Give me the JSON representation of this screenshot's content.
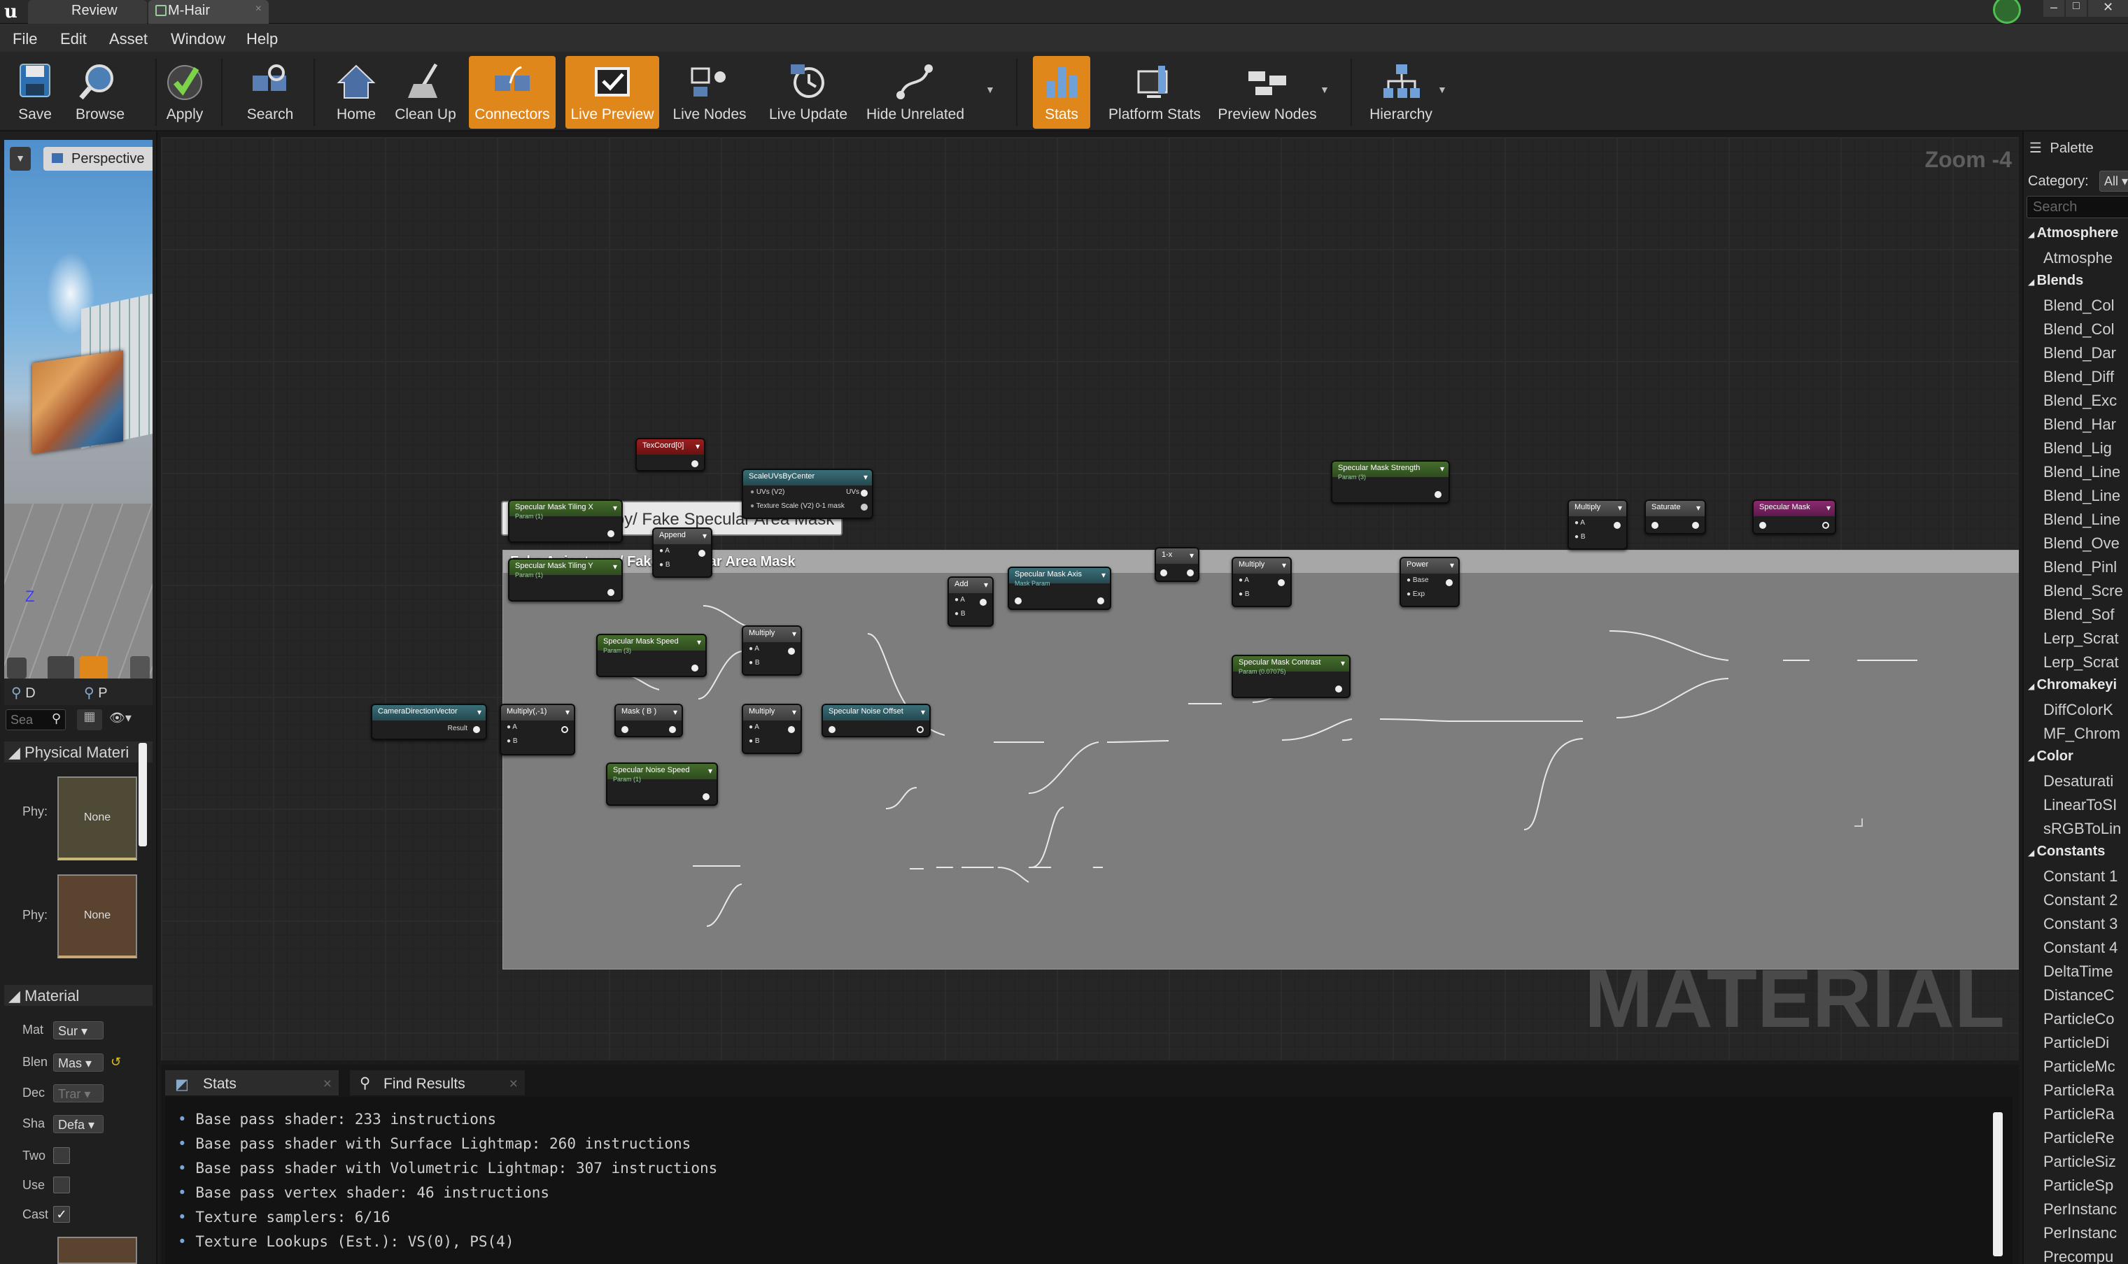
{
  "titlebar": {
    "tabs": [
      "Review",
      "M-Hair"
    ]
  },
  "menu": [
    "File",
    "Edit",
    "Asset",
    "Window",
    "Help"
  ],
  "toolbar": [
    {
      "label": "Save",
      "icon": "save-icon",
      "active": false
    },
    {
      "label": "Browse",
      "icon": "browse-icon",
      "active": false
    },
    {
      "label": "Apply",
      "icon": "apply-icon",
      "active": false
    },
    {
      "label": "Search",
      "icon": "search-icon",
      "active": false
    },
    {
      "label": "Home",
      "icon": "home-icon",
      "active": false
    },
    {
      "label": "Clean Up",
      "icon": "clean-up-icon",
      "active": false
    },
    {
      "label": "Connectors",
      "icon": "connectors-icon",
      "active": true
    },
    {
      "label": "Live Preview",
      "icon": "live-preview-icon",
      "active": true
    },
    {
      "label": "Live Nodes",
      "icon": "live-nodes-icon",
      "active": false
    },
    {
      "label": "Live Update",
      "icon": "live-update-icon",
      "active": false
    },
    {
      "label": "Hide Unrelated",
      "icon": "hide-unrelated-icon",
      "active": false
    },
    {
      "label": "Stats",
      "icon": "stats-icon",
      "active": true
    },
    {
      "label": "Platform Stats",
      "icon": "platform-stats-icon",
      "active": false
    },
    {
      "label": "Preview Nodes",
      "icon": "preview-nodes-icon",
      "active": false
    },
    {
      "label": "Hierarchy",
      "icon": "hierarchy-icon",
      "active": false
    }
  ],
  "viewport": {
    "mode": "Perspective"
  },
  "details": {
    "tabs": [
      "D",
      "P"
    ],
    "search_placeholder": "Sea",
    "section_physical": "Physical Materi",
    "phys_label": "Phy:",
    "phys_none": "None",
    "section_material": "Material",
    "rows": [
      {
        "k": "Mat",
        "v": "Sur"
      },
      {
        "k": "Blen",
        "v": "Mas"
      },
      {
        "k": "Dec",
        "v": "Trar"
      },
      {
        "k": "Sha",
        "v": "Defa"
      }
    ],
    "checks": [
      {
        "k": "Two",
        "checked": false
      },
      {
        "k": "Use",
        "checked": false
      },
      {
        "k": "Cast",
        "checked": true
      }
    ]
  },
  "graph": {
    "zoom": "Zoom -4",
    "watermark": "MATERIAL",
    "comment_bubble": "Fake Anisotropy/ Fake Specular Area Mask",
    "comment_title": "Fake Anisotropy/ Fake Specular Area Mask",
    "nodes": {
      "texcoord": "TexCoord[0]",
      "scaleuv": "ScaleUVsByCenter",
      "scaleuv_in1": "UVs (V2)",
      "scaleuv_in2": "Texture Scale (V2) 0-1 mask",
      "scaleuv_out": "UVs",
      "tilingx": "Specular Mask Tiling X",
      "tilingx_sub": "Param (1)",
      "tilingy": "Specular Mask Tiling Y",
      "tilingy_sub": "Param (1)",
      "append": "Append",
      "speed": "Specular Mask Speed",
      "speed_sub": "Param (3)",
      "camera": "CameraDirectionVector",
      "camera_out": "Result",
      "mulneg": "Multiply(,-1)",
      "mask": "Mask ( B )",
      "multiply1": "Multiply",
      "multiply2": "Multiply",
      "noiseoffset": "Specular Noise Offset",
      "noisespeed": "Specular Noise Speed",
      "noisespeed_sub": "Param (1)",
      "add": "Add",
      "axis": "Specular Mask Axis",
      "axis_sub": "Mask Param",
      "oneminus": "1-x",
      "multiply3": "Multiply",
      "strength": "Specular Mask Strength",
      "strength_sub": "Param (3)",
      "contrast": "Specular Mask Contrast",
      "contrast_sub": "Param (0.07075)",
      "power": "Power",
      "power_base": "Base",
      "power_exp": "Exp",
      "multiply4": "Multiply",
      "saturate": "Saturate",
      "specmask": "Specular Mask",
      "pin_a": "A",
      "pin_b": "B"
    }
  },
  "palette": {
    "title": "Palette",
    "category_label": "Category:",
    "category_value": "All",
    "search_placeholder": "Search",
    "groups": [
      {
        "name": "Atmosphere",
        "items": [
          "Atmosphe"
        ]
      },
      {
        "name": "Blends",
        "items": [
          "Blend_Col",
          "Blend_Col",
          "Blend_Dar",
          "Blend_Diff",
          "Blend_Exc",
          "Blend_Har",
          "Blend_Lig",
          "Blend_Line",
          "Blend_Line",
          "Blend_Line",
          "Blend_Ove",
          "Blend_Pinl",
          "Blend_Scre",
          "Blend_Sof",
          "Lerp_Scrat",
          "Lerp_Scrat"
        ]
      },
      {
        "name": "Chromakeyi",
        "items": [
          "DiffColorK",
          "MF_Chrom"
        ]
      },
      {
        "name": "Color",
        "items": [
          "Desaturati",
          "LinearToSI",
          "sRGBToLin"
        ]
      },
      {
        "name": "Constants",
        "items": [
          "Constant 1",
          "Constant 2",
          "Constant 3",
          "Constant 4",
          "DeltaTime",
          "DistanceC",
          "ParticleCo",
          "ParticleDi",
          "ParticleMc",
          "ParticleRa",
          "ParticleRa",
          "ParticleRe",
          "ParticleSiz",
          "ParticleSp",
          "PerInstanc",
          "PerInstanc",
          "Precompu"
        ]
      }
    ]
  },
  "bottom": {
    "tabs": [
      "Stats",
      "Find Results"
    ],
    "stats": [
      "Base pass shader: 233 instructions",
      "Base pass shader with Surface Lightmap: 260 instructions",
      "Base pass shader with Volumetric Lightmap: 307 instructions",
      "Base pass vertex shader: 46 instructions",
      "Texture samplers: 6/16",
      "Texture Lookups (Est.): VS(0), PS(4)"
    ]
  }
}
